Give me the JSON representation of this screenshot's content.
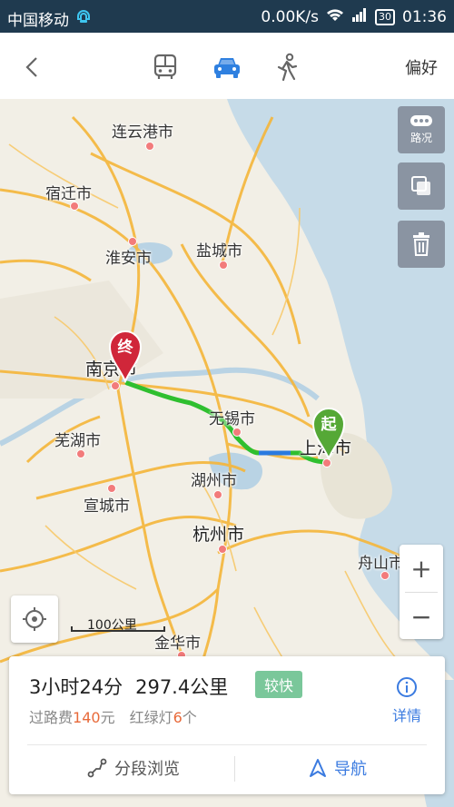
{
  "status_bar": {
    "carrier": "中国移动",
    "speed": "0.00K/s",
    "battery": "30",
    "time": "01:36"
  },
  "nav": {
    "preferences_label": "偏好",
    "modes": [
      "bus-icon",
      "car-icon",
      "walk-icon"
    ],
    "active_mode": "car-icon"
  },
  "map": {
    "traffic_label": "路况",
    "scale_label": "100公里",
    "cities": {
      "lianyungang": "连云港市",
      "suqian": "宿迁市",
      "huaian": "淮安市",
      "yancheng": "盐城市",
      "nanjing": "南京市",
      "wuhu": "芜湖市",
      "wuxi": "无锡市",
      "shanghai": "上海市",
      "huzhou": "湖州市",
      "xuancheng": "宣城市",
      "hangzhou": "杭州市",
      "zhoushan": "舟山市",
      "jinhua": "金华市"
    },
    "start_marker": "起",
    "end_marker": "终",
    "zoom_in": "+",
    "zoom_out": "−",
    "colors": {
      "route": "#2fbf2f",
      "route_slow": "#2a7ae0",
      "sea": "#c6dbe8",
      "road": "#f5b63a"
    }
  },
  "route": {
    "duration": "3小时24分",
    "distance": "297.4公里",
    "tag": "较快",
    "toll_label": "过路费",
    "toll_value": "140",
    "toll_unit": "元",
    "lights_label": "红绿灯",
    "lights_value": "6",
    "lights_unit": "个",
    "details_label": "详情",
    "segment_label": "分段浏览",
    "navigate_label": "导航"
  }
}
